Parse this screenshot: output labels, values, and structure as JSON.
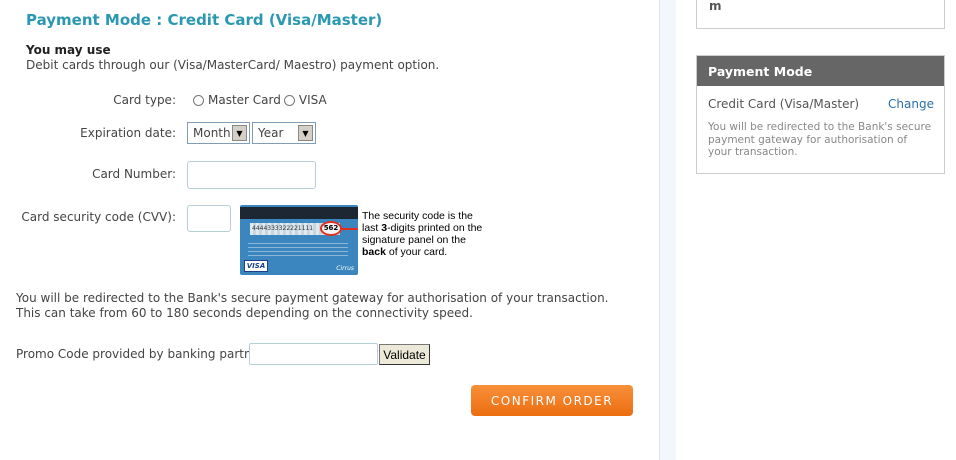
{
  "payment": {
    "title": "Payment Mode : Credit Card (Visa/Master)",
    "may_use_heading": "You may use",
    "may_use_desc": "Debit cards through our (Visa/MasterCard/ Maestro) payment option.",
    "card_type_label": "Card type:",
    "card_type_options": [
      "Master Card",
      "VISA"
    ],
    "expiration_label": "Expiration date:",
    "month_select": "Month",
    "year_select": "Year",
    "card_number_label": "Card Number:",
    "card_number_value": "",
    "cvv_label": "Card security code (CVV):",
    "cvv_value": "",
    "cvv_hint": {
      "part1": "The security code is the last ",
      "bold1": "3",
      "part2": "-digits printed on the signature panel on the ",
      "bold2": "back",
      "part3": " of your card.",
      "card_number_sample": "4444333322221111",
      "card_cvv_sample": "562",
      "card_brand": "VISA",
      "card_network": "Cirrus"
    },
    "redirect_line1": "You will be redirected to the Bank's secure payment gateway for authorisation of your transaction.",
    "redirect_line2": "This can take from 60 to 180 seconds depending on the connectivity speed.",
    "promo_label": "Promo Code provided by banking partner",
    "promo_value": "",
    "validate_label": "Validate",
    "confirm_label": "CONFIRM ORDER"
  },
  "sidebar": {
    "top_box_text": "m",
    "payment_mode_heading": "Payment Mode",
    "selected_mode": "Credit Card (Visa/Master)",
    "change_link": "Change",
    "note": "You will be redirected to the Bank's secure payment gateway for authorisation of your transaction."
  },
  "colors": {
    "title": "#2a98b0",
    "confirm_button": "#ec6d10",
    "sidebar_header": "#666666",
    "link": "#2a6fa8"
  }
}
